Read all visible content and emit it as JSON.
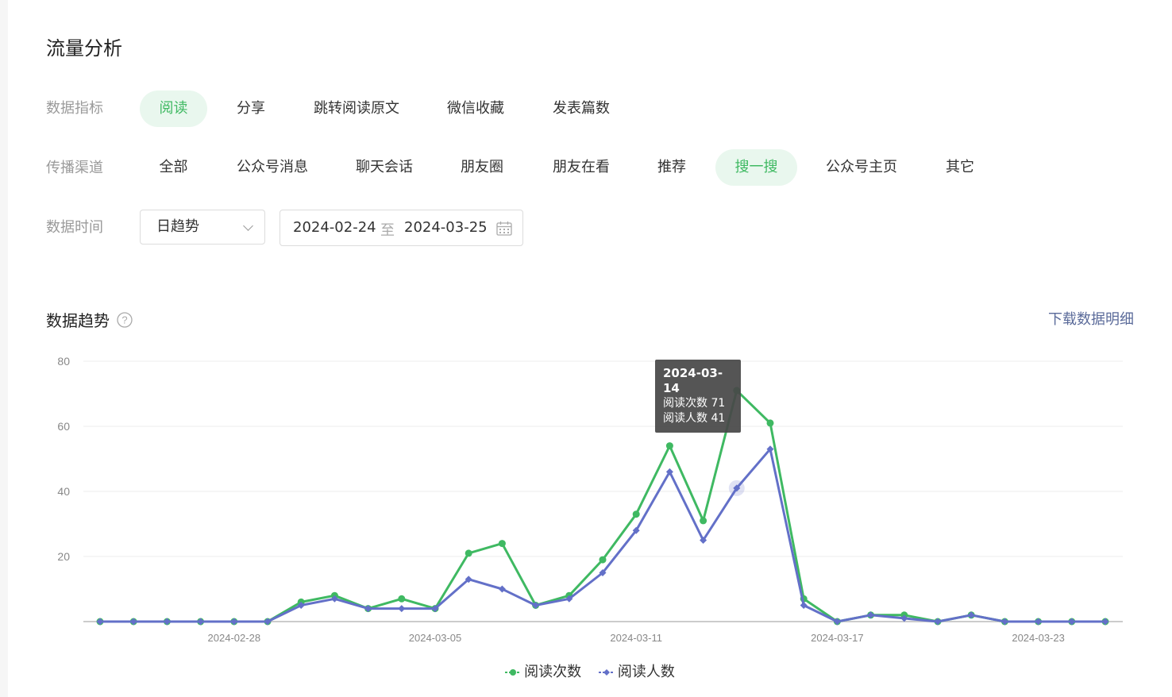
{
  "title": "流量分析",
  "metrics": {
    "label": "数据指标",
    "items": [
      "阅读",
      "分享",
      "跳转阅读原文",
      "微信收藏",
      "发表篇数"
    ],
    "active": "阅读"
  },
  "channels": {
    "label": "传播渠道",
    "items": [
      "全部",
      "公众号消息",
      "聊天会话",
      "朋友圈",
      "朋友在看",
      "推荐",
      "搜一搜",
      "公众号主页",
      "其它"
    ],
    "active": "搜一搜"
  },
  "time": {
    "label": "数据时间",
    "granularity": "日趋势",
    "start": "2024-02-24",
    "separator": "至",
    "end": "2024-03-25"
  },
  "section": {
    "title": "数据趋势",
    "download": "下载数据明细"
  },
  "colors": {
    "green": "#3fb962",
    "blue": "#6370c8",
    "active_bg": "#e9f7ee"
  },
  "chart_data": {
    "type": "line",
    "x": [
      "2024-02-24",
      "2024-02-25",
      "2024-02-26",
      "2024-02-27",
      "2024-02-28",
      "2024-02-29",
      "2024-03-01",
      "2024-03-02",
      "2024-03-03",
      "2024-03-04",
      "2024-03-05",
      "2024-03-06",
      "2024-03-07",
      "2024-03-08",
      "2024-03-09",
      "2024-03-10",
      "2024-03-11",
      "2024-03-12",
      "2024-03-13",
      "2024-03-14",
      "2024-03-15",
      "2024-03-16",
      "2024-03-17",
      "2024-03-18",
      "2024-03-19",
      "2024-03-20",
      "2024-03-21",
      "2024-03-22",
      "2024-03-23",
      "2024-03-24",
      "2024-03-25"
    ],
    "xticks": [
      "2024-02-28",
      "2024-03-05",
      "2024-03-11",
      "2024-03-17",
      "2024-03-23"
    ],
    "yticks": [
      20,
      40,
      60,
      80
    ],
    "ylim": [
      0,
      80
    ],
    "series": [
      {
        "name": "阅读次数",
        "values": [
          0,
          0,
          0,
          0,
          0,
          0,
          6,
          8,
          4,
          7,
          4,
          21,
          24,
          5,
          8,
          19,
          33,
          54,
          31,
          71,
          61,
          7,
          0,
          2,
          2,
          0,
          2,
          0,
          0,
          0,
          0
        ]
      },
      {
        "name": "阅读人数",
        "values": [
          0,
          0,
          0,
          0,
          0,
          0,
          5,
          7,
          4,
          4,
          4,
          13,
          10,
          5,
          7,
          15,
          28,
          46,
          25,
          41,
          53,
          5,
          0,
          2,
          1,
          0,
          2,
          0,
          0,
          0,
          0
        ]
      }
    ],
    "tooltip": {
      "date": "2024-03-14",
      "lines": [
        "阅读次数 71",
        "阅读人数 41"
      ]
    }
  }
}
